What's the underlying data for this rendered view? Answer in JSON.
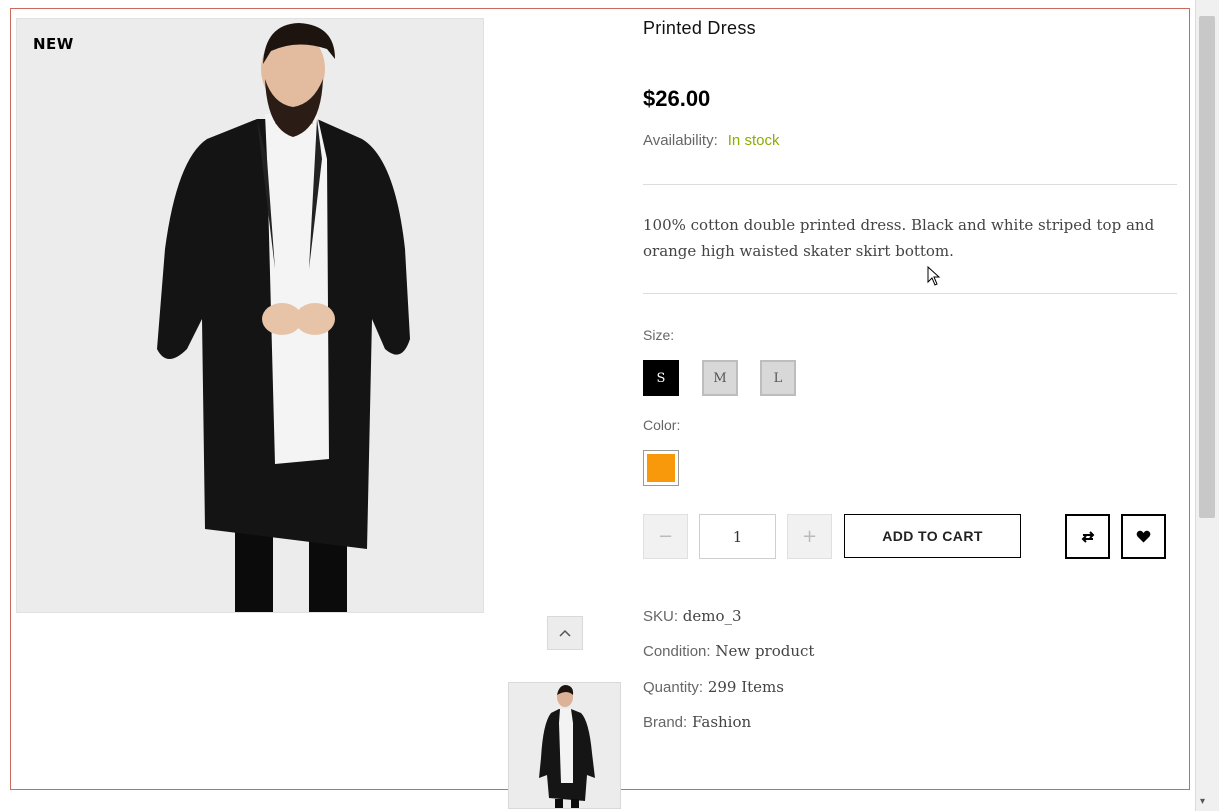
{
  "product": {
    "badge": "NEW",
    "title": "Printed Dress",
    "price": "$26.00",
    "availability_label": "Availability:",
    "availability_value": "In stock",
    "description": "100% cotton double printed dress. Black and white striped top and orange high waisted skater skirt bottom.",
    "size_label": "Size:",
    "sizes": [
      "S",
      "M",
      "L"
    ],
    "selected_size": "S",
    "color_label": "Color:",
    "color_swatch": "#f8990c",
    "quantity": "1",
    "qty_minus": "−",
    "qty_plus": "+",
    "add_to_cart": "ADD TO CART",
    "icons": [
      "compare-icon",
      "heart-icon",
      "chevron-up-icon"
    ],
    "meta": {
      "sku_label": "SKU:",
      "sku_value": "demo_3",
      "condition_label": "Condition:",
      "condition_value": "New product",
      "quantity_label": "Quantity:",
      "quantity_value": "299 Items",
      "brand_label": "Brand:",
      "brand_value": "Fashion"
    }
  },
  "colors": {
    "in_stock": "#8bae00",
    "frame_border": "#c96b5a",
    "image_bg": "#ececec"
  }
}
